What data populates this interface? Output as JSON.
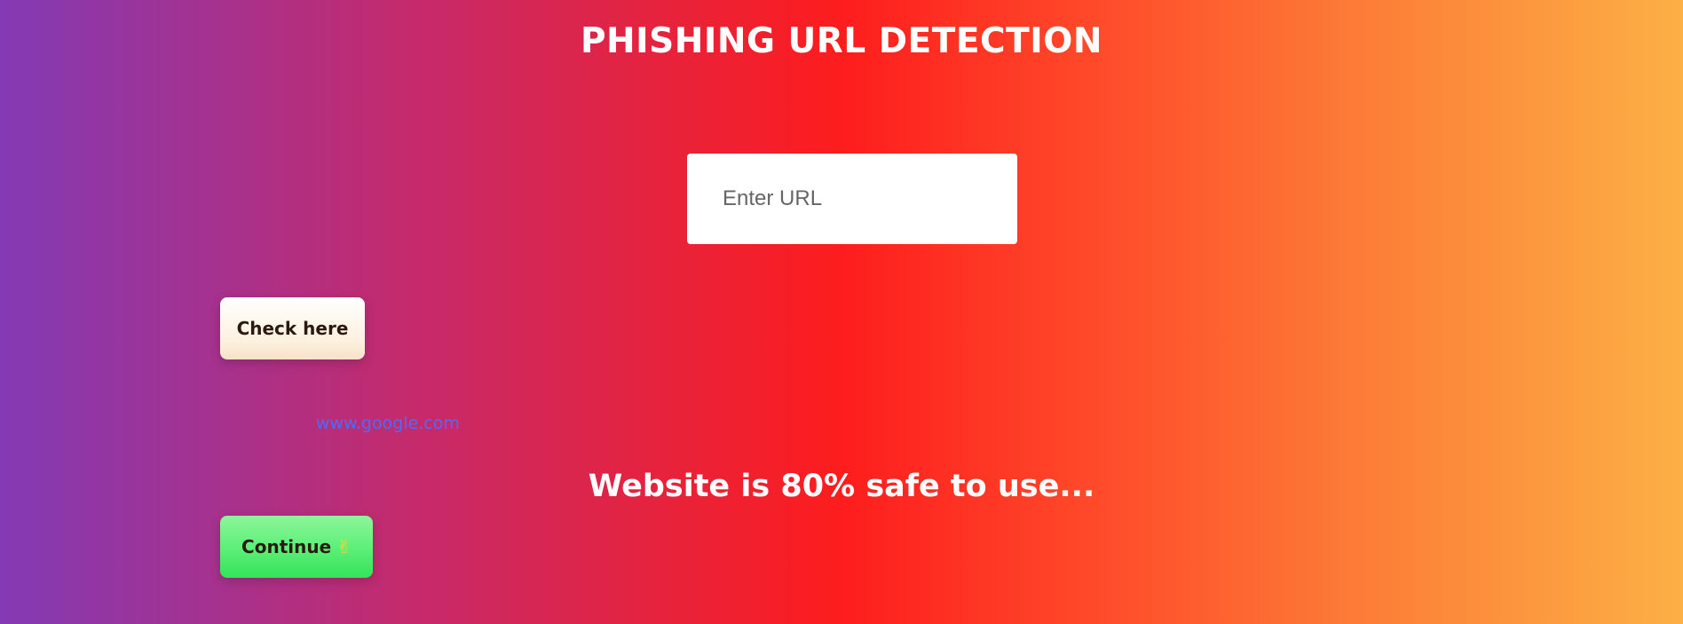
{
  "header": {
    "title": "PHISHING URL DETECTION"
  },
  "form": {
    "url_placeholder": "Enter URL",
    "url_value": "",
    "check_label": "Check here"
  },
  "result": {
    "url": "www.google.com",
    "message": "Website is 80% safe to use...",
    "safety_percent": 80
  },
  "actions": {
    "continue_label": "Continue",
    "continue_icon": "✌"
  },
  "colors": {
    "gradient_start": "#833ab4",
    "gradient_mid": "#fd1d1d",
    "gradient_end": "#fcb045",
    "link": "#4a6cff",
    "continue_button": "#5ff07a"
  }
}
